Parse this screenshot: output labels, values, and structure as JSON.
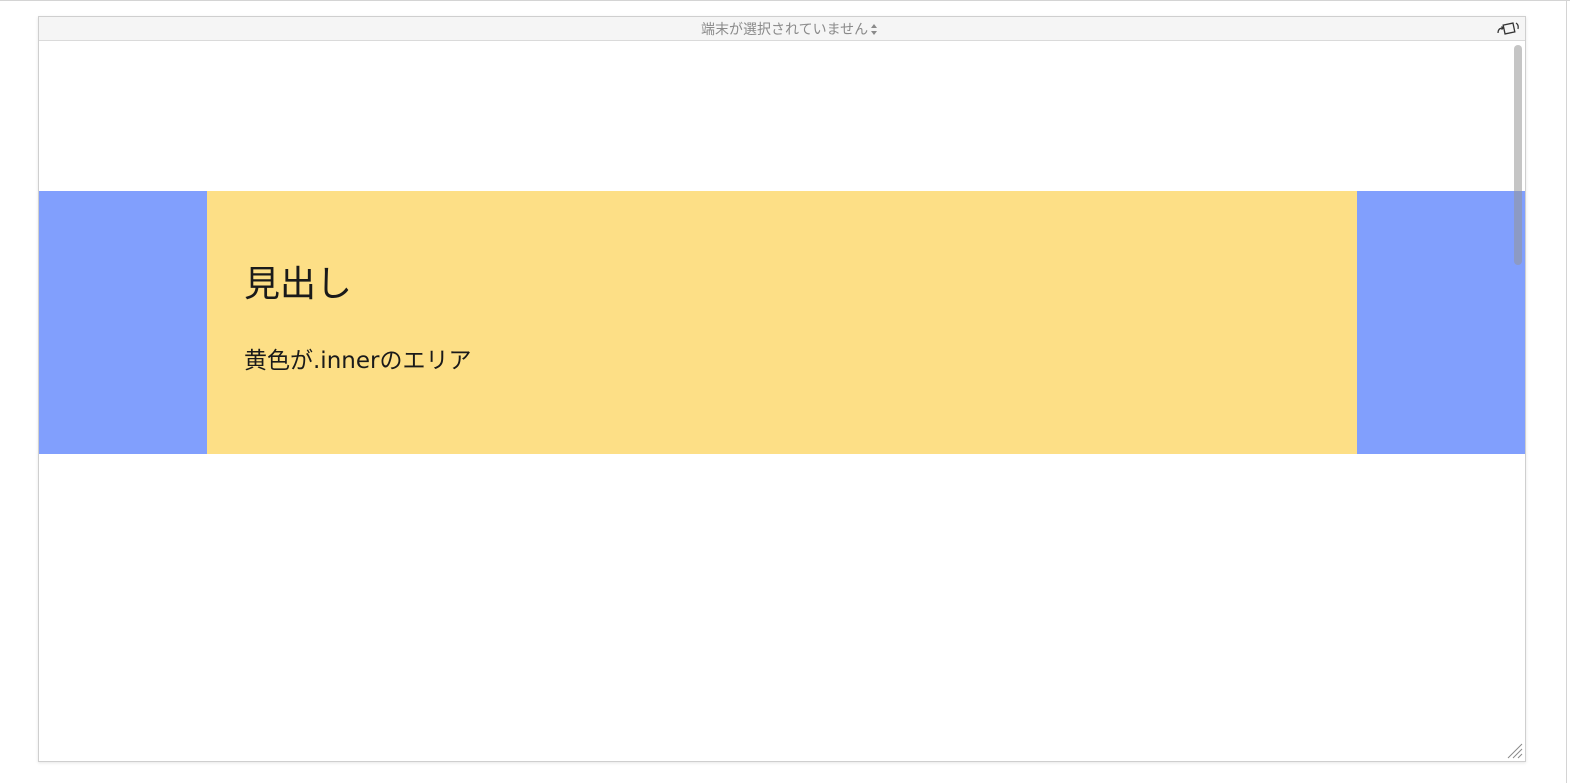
{
  "toolbar": {
    "device_select_label": "端末が選択されていません",
    "rotate_icon": "rotate-device-icon"
  },
  "content": {
    "heading": "見出し",
    "body_text": "黄色が.innerのエリア"
  },
  "colors": {
    "outer_band": "#819ffd",
    "inner_area": "#fddf86",
    "toolbar_bg": "#f5f5f5",
    "toolbar_text": "#8a8a8a"
  },
  "icons": {
    "select_arrows": "select-arrows-icon",
    "resize_grip": "resize-grip-icon"
  }
}
